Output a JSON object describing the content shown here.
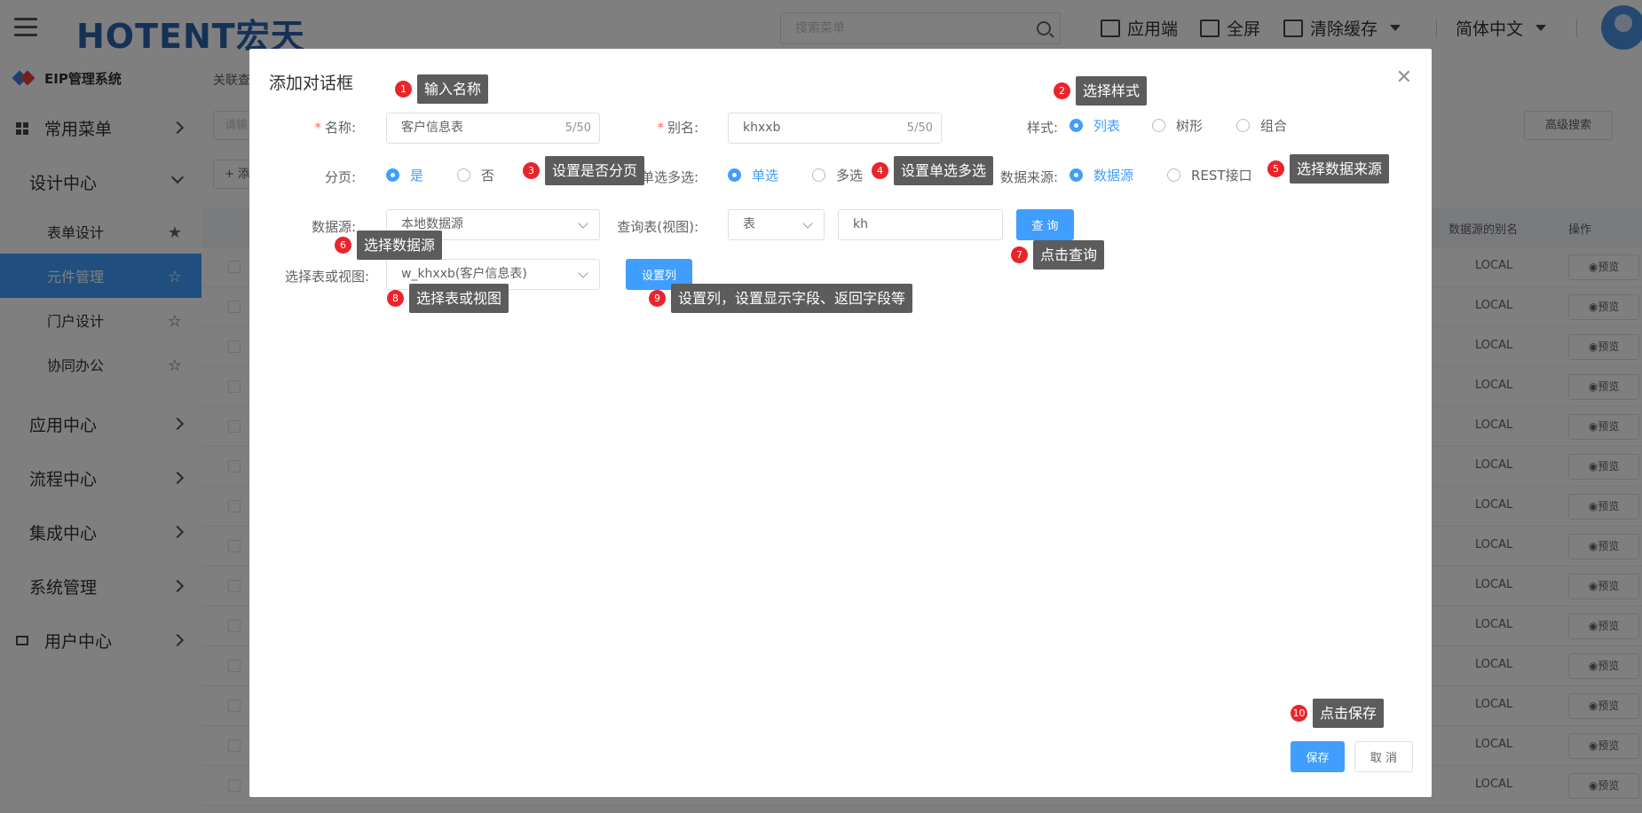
{
  "header": {
    "brand": "HOTENT宏天",
    "search_placeholder": "搜索菜单",
    "app_label": "应用端",
    "fullscreen_label": "全屏",
    "clear_cache_label": "清除缓存",
    "language_label": "简体中文"
  },
  "sidebar": {
    "system_name": "EIP管理系统",
    "menus": [
      {
        "label": "常用菜单"
      },
      {
        "label": "设计中心"
      },
      {
        "label": "应用中心"
      },
      {
        "label": "流程中心"
      },
      {
        "label": "集成中心"
      },
      {
        "label": "系统管理"
      },
      {
        "label": "用户中心"
      }
    ],
    "subs": [
      {
        "label": "表单设计"
      },
      {
        "label": "元件管理"
      },
      {
        "label": "门户设计"
      },
      {
        "label": "协同办公"
      }
    ]
  },
  "background": {
    "breadcrumb": "关联查",
    "search_placeholder": "请输",
    "add_label": "+ 添",
    "adv_search": "高级搜索",
    "col_alias": "数据源的别名",
    "col_op": "操作",
    "cell_alias": "LOCAL",
    "preview": "预览"
  },
  "dialog": {
    "title": "添加对话框",
    "name_label": "名称:",
    "name_value": "客户信息表",
    "name_count": "5/50",
    "alias_label": "别名:",
    "alias_value": "khxxb",
    "alias_count": "5/50",
    "style_label": "样式:",
    "style_opts": [
      "列表",
      "树形",
      "组合"
    ],
    "page_label": "分页:",
    "page_opts": [
      "是",
      "否"
    ],
    "select_label": "单选多选:",
    "select_opts": [
      "单选",
      "多选"
    ],
    "source_label": "数据来源:",
    "source_opts": [
      "数据源",
      "REST接口"
    ],
    "ds_label": "数据源:",
    "ds_value": "本地数据源",
    "query_label": "查询表(视图):",
    "query_type": "表",
    "query_value": "kh",
    "query_btn": "查 询",
    "table_label": "选择表或视图:",
    "table_value": "w_khxxb(客户信息表)",
    "set_col_btn": "设置列",
    "save_btn": "保存",
    "cancel_btn": "取 消"
  },
  "annotations": [
    {
      "n": "1",
      "text": "输入名称"
    },
    {
      "n": "2",
      "text": "选择样式"
    },
    {
      "n": "3",
      "text": "设置是否分页"
    },
    {
      "n": "4",
      "text": "设置单选多选"
    },
    {
      "n": "5",
      "text": "选择数据来源"
    },
    {
      "n": "6",
      "text": "选择数据源"
    },
    {
      "n": "7",
      "text": "点击查询"
    },
    {
      "n": "8",
      "text": "选择表或视图"
    },
    {
      "n": "9",
      "text": "设置列，设置显示字段、返回字段等"
    },
    {
      "n": "10",
      "text": "点击保存"
    }
  ],
  "colors": {
    "accent": "#409eff",
    "annotation": "#e8252b",
    "tip": "#5c5c5c"
  }
}
